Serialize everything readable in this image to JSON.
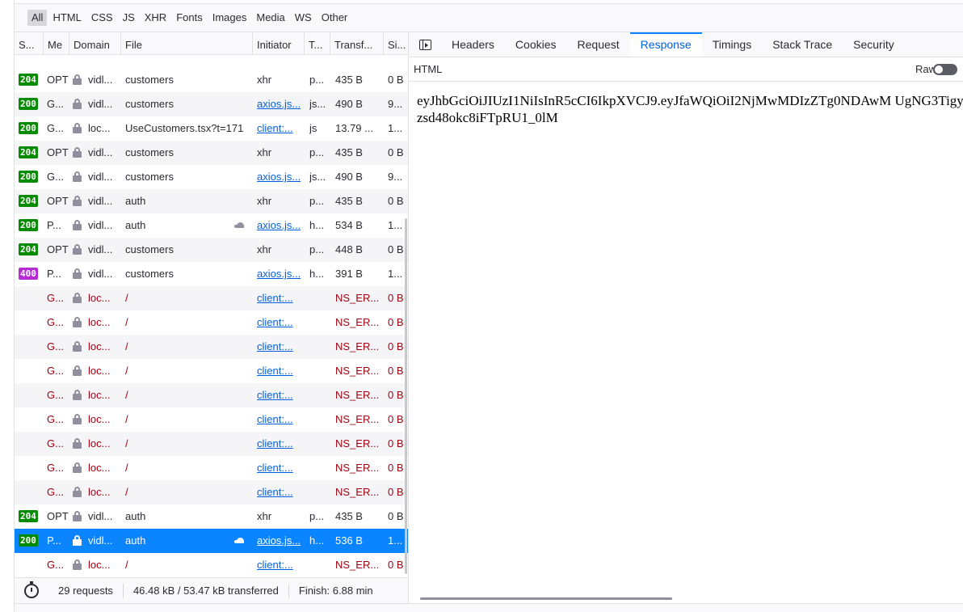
{
  "filters": [
    {
      "label": "All",
      "active": true
    },
    {
      "label": "HTML"
    },
    {
      "label": "CSS"
    },
    {
      "label": "JS"
    },
    {
      "label": "XHR"
    },
    {
      "label": "Fonts"
    },
    {
      "label": "Images"
    },
    {
      "label": "Media"
    },
    {
      "label": "WS"
    },
    {
      "label": "Other"
    }
  ],
  "columns": {
    "status": "S...",
    "method": "Me",
    "domain": "Domain",
    "file": "File",
    "initiator": "Initiator",
    "type": "T...",
    "transferred": "Transf...",
    "size": "Si..."
  },
  "rows": [
    {
      "status": "204",
      "method": "OPT",
      "domain": "vidl...",
      "file": "customers",
      "initiator": "xhr",
      "initiator_link": false,
      "type": "p...",
      "transferred": "435 B",
      "size": "0 B"
    },
    {
      "status": "200",
      "method": "G...",
      "domain": "vidl...",
      "file": "customers",
      "initiator": "axios.js...",
      "initiator_link": true,
      "type": "js...",
      "transferred": "490 B",
      "size": "9..."
    },
    {
      "status": "200",
      "method": "G...",
      "domain": "loc...",
      "file": "UseCustomers.tsx?t=171",
      "initiator": "client:...",
      "initiator_link": true,
      "type": "js",
      "transferred": "13.79 ...",
      "size": "1..."
    },
    {
      "status": "204",
      "method": "OPT",
      "domain": "vidl...",
      "file": "customers",
      "initiator": "xhr",
      "initiator_link": false,
      "type": "p...",
      "transferred": "435 B",
      "size": "0 B"
    },
    {
      "status": "200",
      "method": "G...",
      "domain": "vidl...",
      "file": "customers",
      "initiator": "axios.js...",
      "initiator_link": true,
      "type": "js...",
      "transferred": "490 B",
      "size": "9..."
    },
    {
      "status": "204",
      "method": "OPT",
      "domain": "vidl...",
      "file": "auth",
      "initiator": "xhr",
      "initiator_link": false,
      "type": "p...",
      "transferred": "435 B",
      "size": "0 B"
    },
    {
      "status": "200",
      "method": "P...",
      "domain": "vidl...",
      "file": "auth",
      "slow": true,
      "initiator": "axios.js...",
      "initiator_link": true,
      "type": "h...",
      "transferred": "534 B",
      "size": "1..."
    },
    {
      "status": "204",
      "method": "OPT",
      "domain": "vidl...",
      "file": "customers",
      "initiator": "xhr",
      "initiator_link": false,
      "type": "p...",
      "transferred": "448 B",
      "size": "0 B"
    },
    {
      "status": "400",
      "method": "P...",
      "domain": "vidl...",
      "file": "customers",
      "initiator": "axios.js...",
      "initiator_link": true,
      "type": "h...",
      "transferred": "391 B",
      "size": "1..."
    },
    {
      "status": "",
      "method": "G...",
      "domain": "loc...",
      "file": "/",
      "initiator": "client:...",
      "initiator_link": true,
      "type": "",
      "transferred": "NS_ER...",
      "size": "0 B",
      "error": true
    },
    {
      "status": "",
      "method": "G...",
      "domain": "loc...",
      "file": "/",
      "initiator": "client:...",
      "initiator_link": true,
      "type": "",
      "transferred": "NS_ER...",
      "size": "0 B",
      "error": true
    },
    {
      "status": "",
      "method": "G...",
      "domain": "loc...",
      "file": "/",
      "initiator": "client:...",
      "initiator_link": true,
      "type": "",
      "transferred": "NS_ER...",
      "size": "0 B",
      "error": true
    },
    {
      "status": "",
      "method": "G...",
      "domain": "loc...",
      "file": "/",
      "initiator": "client:...",
      "initiator_link": true,
      "type": "",
      "transferred": "NS_ER...",
      "size": "0 B",
      "error": true
    },
    {
      "status": "",
      "method": "G...",
      "domain": "loc...",
      "file": "/",
      "initiator": "client:...",
      "initiator_link": true,
      "type": "",
      "transferred": "NS_ER...",
      "size": "0 B",
      "error": true
    },
    {
      "status": "",
      "method": "G...",
      "domain": "loc...",
      "file": "/",
      "initiator": "client:...",
      "initiator_link": true,
      "type": "",
      "transferred": "NS_ER...",
      "size": "0 B",
      "error": true
    },
    {
      "status": "",
      "method": "G...",
      "domain": "loc...",
      "file": "/",
      "initiator": "client:...",
      "initiator_link": true,
      "type": "",
      "transferred": "NS_ER...",
      "size": "0 B",
      "error": true
    },
    {
      "status": "",
      "method": "G...",
      "domain": "loc...",
      "file": "/",
      "initiator": "client:...",
      "initiator_link": true,
      "type": "",
      "transferred": "NS_ER...",
      "size": "0 B",
      "error": true
    },
    {
      "status": "",
      "method": "G...",
      "domain": "loc...",
      "file": "/",
      "initiator": "client:...",
      "initiator_link": true,
      "type": "",
      "transferred": "NS_ER...",
      "size": "0 B",
      "error": true
    },
    {
      "status": "204",
      "method": "OPT",
      "domain": "vidl...",
      "file": "auth",
      "initiator": "xhr",
      "initiator_link": false,
      "type": "p...",
      "transferred": "435 B",
      "size": "0 B"
    },
    {
      "status": "200",
      "method": "P...",
      "domain": "vidl...",
      "file": "auth",
      "slow": true,
      "initiator": "axios.js...",
      "initiator_link": true,
      "type": "h...",
      "transferred": "536 B",
      "size": "1...",
      "selected": true
    },
    {
      "status": "",
      "method": "G...",
      "domain": "loc...",
      "file": "/",
      "initiator": "client:...",
      "initiator_link": true,
      "type": "",
      "transferred": "NS_ER...",
      "size": "0 B",
      "error": true
    }
  ],
  "footer": {
    "requests": "29 requests",
    "transferred": "46.48 kB / 53.47 kB transferred",
    "finish": "Finish: 6.88 min"
  },
  "details": {
    "tabs": [
      "Headers",
      "Cookies",
      "Request",
      "Response",
      "Timings",
      "Stack Trace",
      "Security"
    ],
    "active_tab": "Response",
    "sub_label": "HTML",
    "raw_label": "Raw",
    "raw_enabled": false,
    "body": "eyJhbGciOiJIUzI1NiIsInR5cCI6IkpXVCJ9.eyJfaWQiOiI2NjMwMDIzZTg0NDAwM UgNG3Tigyzsd48okc8iFTpRU1_0lM"
  },
  "colors": {
    "accent": "#0a84ff",
    "status_ok": "#058b00",
    "status_client_error": "#b82ad4",
    "error_text": "#a4000f",
    "link": "#0060df"
  }
}
